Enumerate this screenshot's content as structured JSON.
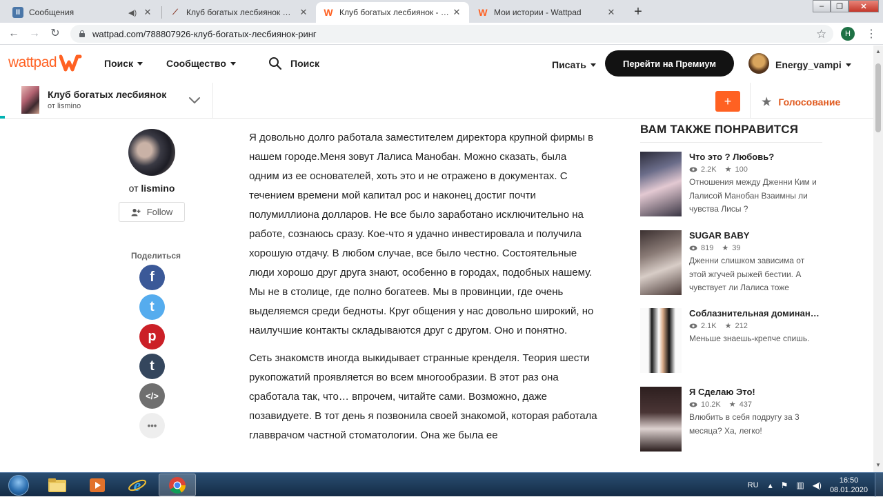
{
  "browser": {
    "tabs": [
      {
        "label": "Сообщения",
        "favicon": "messages-icon",
        "active": false
      },
      {
        "label": "Клуб богатых лесбиянок — ориги",
        "favicon": "feather-icon",
        "active": false
      },
      {
        "label": "Клуб богатых лесбиянок - Ринг",
        "favicon": "wattpad-icon",
        "active": true
      },
      {
        "label": "Мои истории - Wattpad",
        "favicon": "wattpad-icon",
        "active": false
      }
    ],
    "url": "wattpad.com/788807926-клуб-богатых-лесбиянок-ринг",
    "profile_initial": "Н"
  },
  "header": {
    "logo_text": "wattpad",
    "nav": [
      {
        "label": "Поиск"
      },
      {
        "label": "Сообщество"
      }
    ],
    "search_label": "Поиск",
    "write_label": "Писать",
    "premium_label": "Перейти на Премиум",
    "username": "Energy_vampi"
  },
  "story_bar": {
    "title": "Клуб богатых лесбиянок",
    "author": "от lismino",
    "add_label": "+",
    "vote_label": "Голосование"
  },
  "author_panel": {
    "by_prefix": "от ",
    "author_name": "lismino",
    "follow_label": "Follow",
    "share_label": "Поделиться",
    "share_buttons": [
      {
        "icon": "facebook-icon",
        "glyph": "f",
        "color": "#3b5998"
      },
      {
        "icon": "twitter-icon",
        "glyph": "t",
        "color": "#55acee"
      },
      {
        "icon": "pinterest-icon",
        "glyph": "p",
        "color": "#cb2027"
      },
      {
        "icon": "tumblr-icon",
        "glyph": "t",
        "color": "#34465d"
      },
      {
        "icon": "embed-icon",
        "glyph": "</>",
        "color": "#6f6f6f"
      },
      {
        "icon": "more-icon",
        "glyph": "•••",
        "color": "#eeeeee"
      }
    ]
  },
  "reader": {
    "paragraphs": [
      "Я довольно долго работала заместителем директора крупной фирмы в нашем городе.Меня зовут Лалиса Манобан. Можно сказать, была одним из ее основателей, хоть это и не отражено в документах. С течением времени мой капитал рос и наконец достиг почти полумиллиона долларов. Не все было заработано исключительно на работе, сознаюсь сразу. Кое-что я удачно инвестировала и получила хорошую отдачу. В любом случае, все было честно. Состоятельные люди хорошо друг друга знают, особенно в городах, подобных нашему. Мы не в столице, где полно богатеев. Мы в провинции, где очень выделяемся среди бедноты. Круг общения у нас довольно широкий, но наилучшие контакты складываются друг с другом. Оно и понятно.",
      "Сеть знакомств иногда выкидывает странные кренделя. Теория шести рукопожатий проявляется во всем многообразии. В этот раз она сработала так, что… впрочем, читайте сами. Возможно, даже позавидуете. В тот день я позвонила своей знакомой, которая работала главврачом частной стоматологии. Она же была ее"
    ]
  },
  "recommendations": {
    "heading": "ВАМ ТАКЖЕ ПОНРАВИТСЯ",
    "items": [
      {
        "title": "Что это ? Любовь?",
        "reads": "2.2K",
        "votes": "100",
        "description": "Отношения между Дженни Ким и Лалисой Манобан Взаимны ли чувства Лисы ?"
      },
      {
        "title": "SUGAR BABY",
        "reads": "819",
        "votes": "39",
        "description": "Дженни слишком зависима от этой жгучей рыжей бестии. А чувствует ли Лалиса тоже"
      },
      {
        "title": "Соблазнительная доминантка",
        "reads": "2.1K",
        "votes": "212",
        "description": "Меньше знаешь-крепче спишь."
      },
      {
        "title": "Я Сделаю Это!",
        "reads": "10.2K",
        "votes": "437",
        "description": "Влюбить в себя подругу за 3 месяца?  Ха, легко!"
      }
    ]
  },
  "taskbar": {
    "apps": [
      "explorer-icon",
      "media-player-icon",
      "internet-explorer-icon",
      "chrome-icon"
    ],
    "lang": "RU",
    "time": "16:50",
    "date": "08.01.2020"
  }
}
